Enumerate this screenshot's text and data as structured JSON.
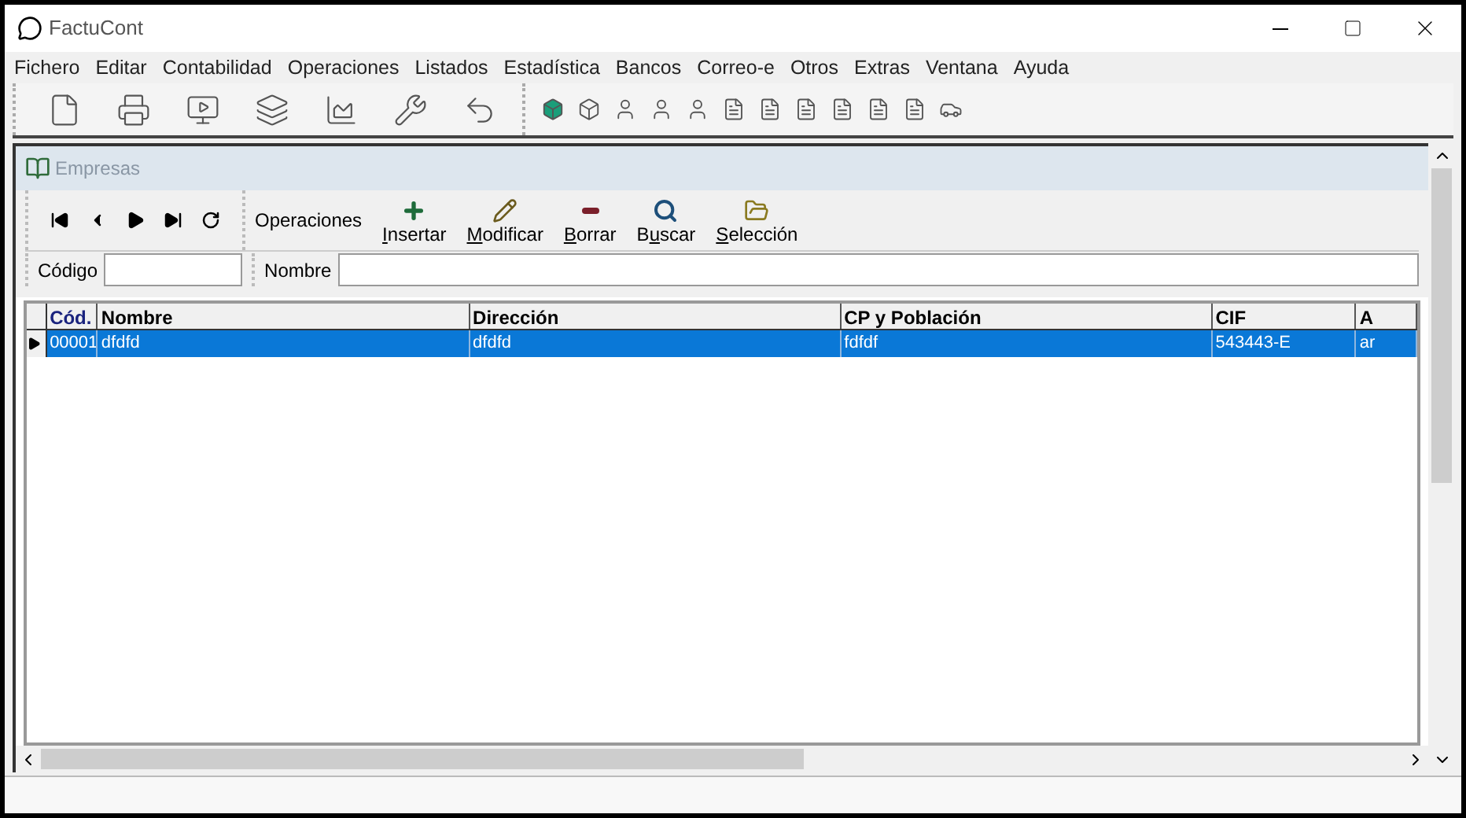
{
  "window": {
    "title": "FactuCont"
  },
  "menu": [
    "Fichero",
    "Editar",
    "Contabilidad",
    "Operaciones",
    "Listados",
    "Estadística",
    "Bancos",
    "Correo-e",
    "Otros",
    "Extras",
    "Ventana",
    "Ayuda"
  ],
  "child_window": {
    "title": "Empresas"
  },
  "operations_label": "Operaciones",
  "operations": [
    {
      "kind": "insert",
      "underlined": "I",
      "rest": "nsertar"
    },
    {
      "kind": "edit",
      "underlined": "M",
      "rest": "odificar"
    },
    {
      "kind": "delete",
      "underlined": "B",
      "rest": "orrar"
    },
    {
      "kind": "search",
      "before": "B",
      "underlined": "u",
      "rest": "scar"
    },
    {
      "kind": "select",
      "underlined": "S",
      "rest": "elección"
    }
  ],
  "filters": [
    {
      "label": "Código"
    },
    {
      "label": "Nombre"
    }
  ],
  "table": {
    "columns": [
      "Cód.",
      "Nombre",
      "Dirección",
      "CP y Población",
      "CIF",
      "A"
    ],
    "rows": [
      {
        "selected": true,
        "cells": [
          "00001",
          "dfdfd",
          "dfdfd",
          "fdfdf",
          "543443-E",
          "ar"
        ]
      }
    ]
  }
}
